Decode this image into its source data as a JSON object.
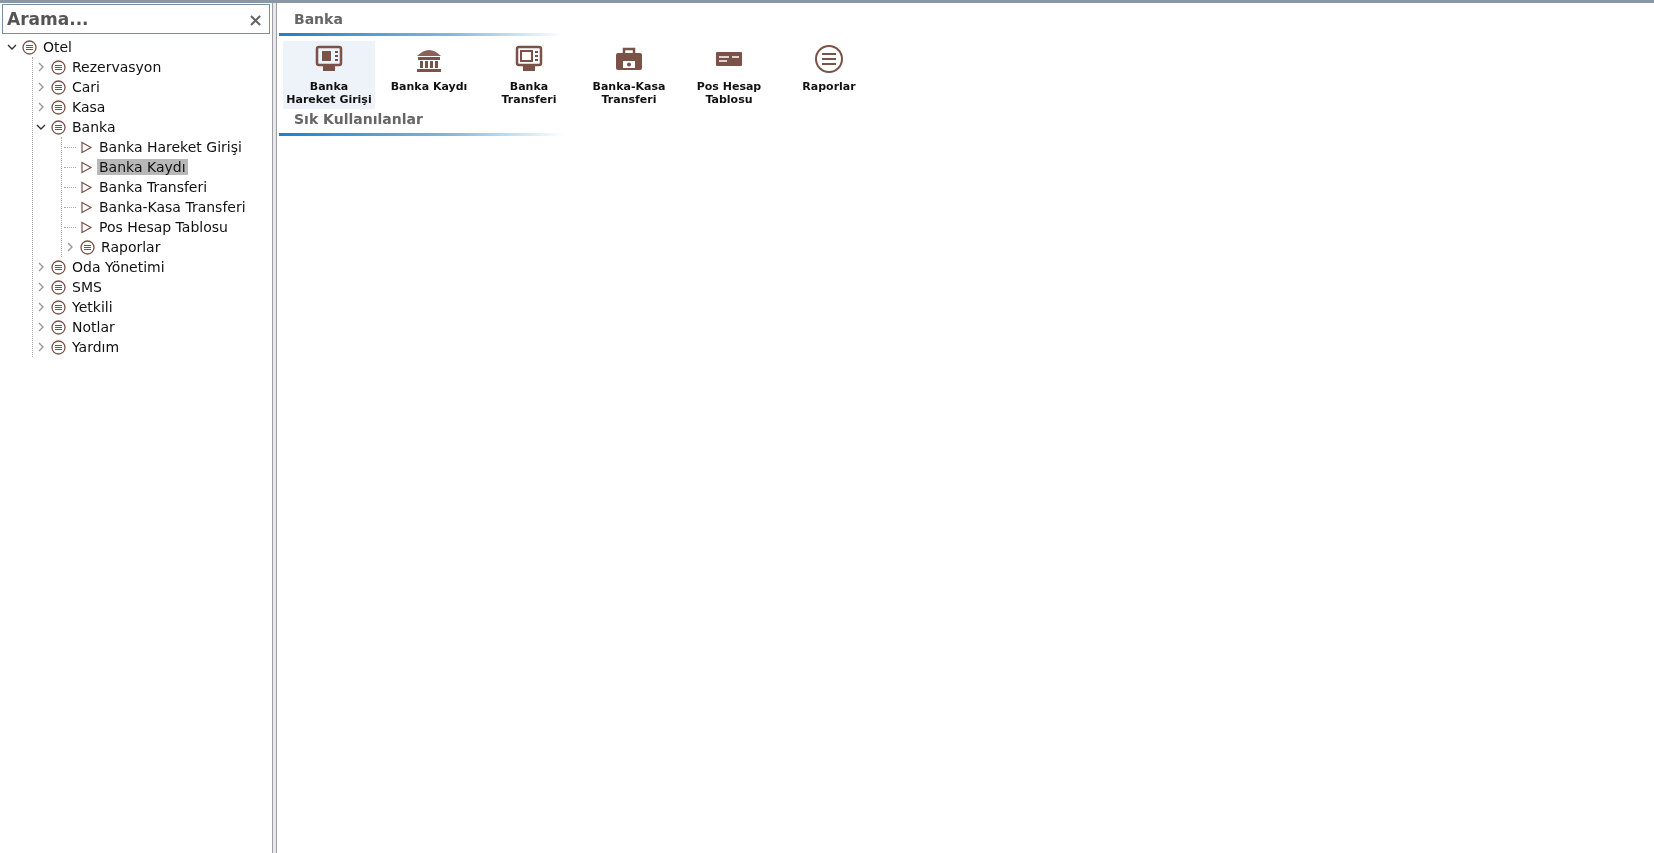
{
  "search": {
    "placeholder": "Arama...",
    "clear": "×"
  },
  "tree": [
    {
      "label": "Otel",
      "kind": "group",
      "expanded": true,
      "selected": false,
      "children": [
        {
          "label": "Rezervasyon",
          "kind": "group",
          "expanded": false,
          "selected": false
        },
        {
          "label": "Cari",
          "kind": "group",
          "expanded": false,
          "selected": false
        },
        {
          "label": "Kasa",
          "kind": "group",
          "expanded": false,
          "selected": false
        },
        {
          "label": "Banka",
          "kind": "group",
          "expanded": true,
          "selected": false,
          "children": [
            {
              "label": "Banka Hareket Girişi",
              "kind": "leaf",
              "selected": false
            },
            {
              "label": "Banka Kaydı",
              "kind": "leaf",
              "selected": true
            },
            {
              "label": "Banka Transferi",
              "kind": "leaf",
              "selected": false
            },
            {
              "label": "Banka-Kasa Transferi",
              "kind": "leaf",
              "selected": false
            },
            {
              "label": "Pos Hesap Tablosu",
              "kind": "leaf",
              "selected": false
            },
            {
              "label": "Raporlar",
              "kind": "group",
              "expanded": false,
              "selected": false
            }
          ]
        },
        {
          "label": "Oda Yönetimi",
          "kind": "group",
          "expanded": false,
          "selected": false
        },
        {
          "label": "SMS",
          "kind": "group",
          "expanded": false,
          "selected": false
        },
        {
          "label": "Yetkili",
          "kind": "group",
          "expanded": false,
          "selected": false
        },
        {
          "label": "Notlar",
          "kind": "group",
          "expanded": false,
          "selected": false
        },
        {
          "label": "Yardım",
          "kind": "group",
          "expanded": false,
          "selected": false
        }
      ]
    }
  ],
  "panel": {
    "title": "Banka",
    "tiles": [
      {
        "label": "Banka Hareket Girişi",
        "kind": "atm-yen",
        "selected": true
      },
      {
        "label": "Banka Kaydı",
        "kind": "bank",
        "selected": false
      },
      {
        "label": "Banka Transferi",
        "kind": "atm",
        "selected": false
      },
      {
        "label": "Banka-Kasa Transferi",
        "kind": "register",
        "selected": false
      },
      {
        "label": "Pos Hesap Tablosu",
        "kind": "card",
        "selected": false
      },
      {
        "label": "Raporlar",
        "kind": "list",
        "selected": false
      }
    ],
    "section_title": "Sık Kullanılanlar"
  }
}
